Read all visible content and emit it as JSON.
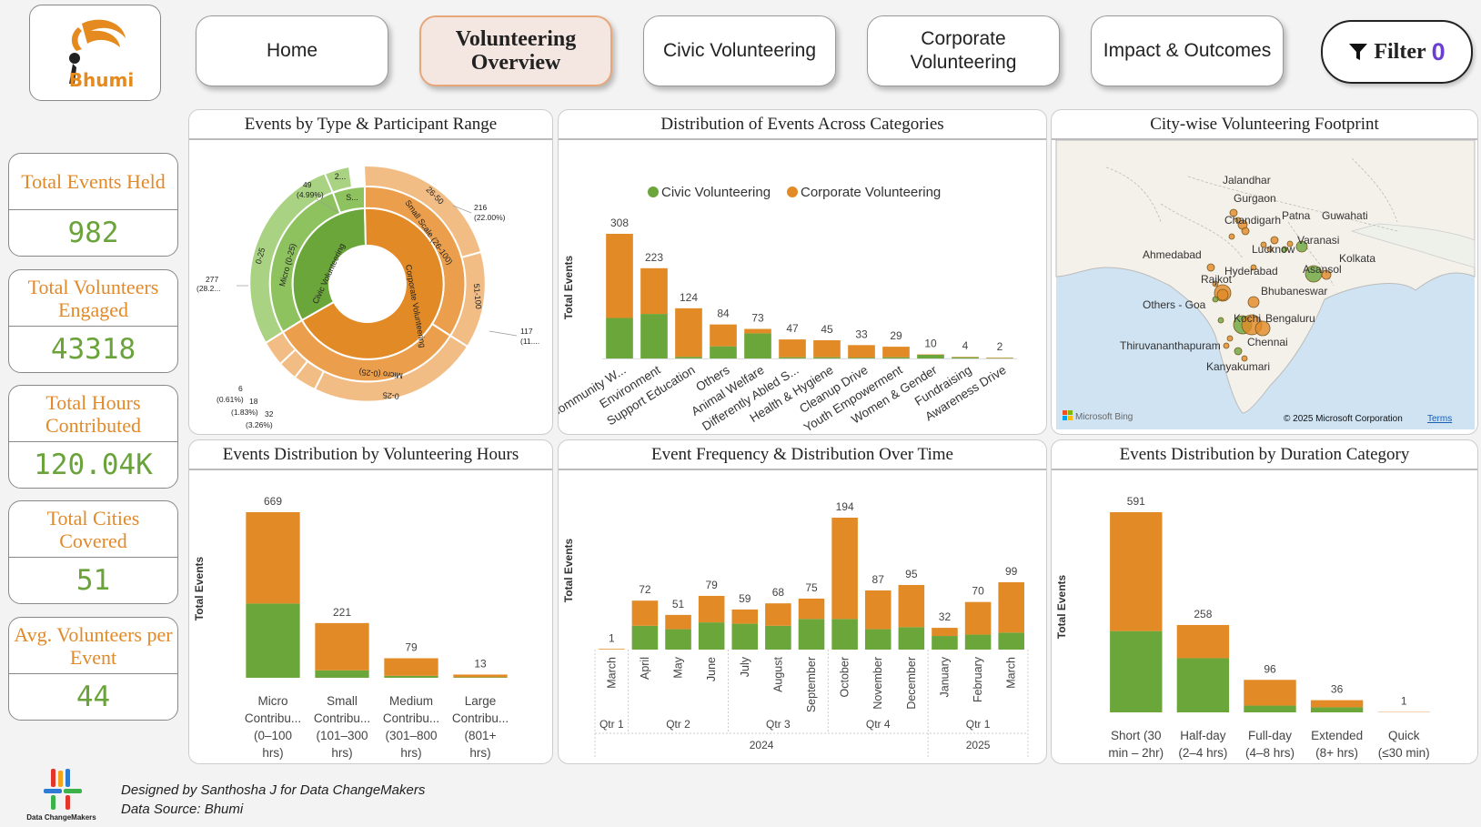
{
  "brand": {
    "name": "Bhumi"
  },
  "nav": {
    "home": "Home",
    "overview": "Volunteering Overview",
    "civic": "Civic Volunteering",
    "corporate": "Corporate Volunteering",
    "impact": "Impact & Outcomes",
    "filter_label": "Filter",
    "filter_count": "0"
  },
  "kpis": [
    {
      "title": "Total Events Held",
      "value": "982"
    },
    {
      "title": "Total Volunteers Engaged",
      "value": "43318"
    },
    {
      "title": "Total Hours Contributed",
      "value": "120.04K"
    },
    {
      "title": "Total Cities Covered",
      "value": "51"
    },
    {
      "title": "Avg. Volunteers per Event",
      "value": "44"
    }
  ],
  "colors": {
    "civic": "#6aa63a",
    "corporate": "#e28a26",
    "accent_text": "#e08a2a",
    "kpi_value": "#6aa33a",
    "filter": "#6b3fd1"
  },
  "panels": {
    "sunburst_title": "Events by Type & Participant Range",
    "categories_title": "Distribution of Events Across Categories",
    "map_title": "City-wise Volunteering Footprint",
    "hours_title": "Events Distribution by Volunteering Hours",
    "time_title": "Event Frequency & Distribution Over Time",
    "duration_title": "Events Distribution by Duration Category"
  },
  "legend": {
    "civic": "Civic Volunteering",
    "corporate": "Corporate Volunteering"
  },
  "sunburst": {
    "inner": [
      {
        "label": "Civic Volunteering"
      },
      {
        "label": "Corporate Volunteering"
      }
    ],
    "middle": [
      "Micro (0-25)",
      "S...",
      "Small Scale (26-100)",
      "Micro (0-25)"
    ],
    "outer": [
      "0-25",
      "2...",
      "26-50",
      "51-100",
      "0-25"
    ],
    "callouts": [
      {
        "value": "49",
        "pct": "(4.99%)"
      },
      {
        "value": "216",
        "pct": "(22.00%)"
      },
      {
        "value": "277",
        "pct": "(28.2..."
      },
      {
        "value": "117",
        "pct": "(11...."
      },
      {
        "value": "6",
        "pct": "(0.61%)"
      },
      {
        "value": "18",
        "pct": "(1.83%)"
      },
      {
        "value": "32",
        "pct": "(3.26%)"
      }
    ]
  },
  "map": {
    "cities": [
      "Jalandhar",
      "Gurgaon",
      "Chandigarh",
      "Patna",
      "Guwahati",
      "Varanasi",
      "Lucknow",
      "Ahmedabad",
      "Kolkata",
      "Hyderabad",
      "Asansol",
      "Rajkot",
      "Bhubaneswar",
      "Others - Goa",
      "Kochi",
      "Bengaluru",
      "Thiruvananthapuram",
      "Chennai",
      "Kanyakumari"
    ],
    "bing": "Microsoft Bing",
    "copyright": "© 2025 Microsoft Corporation",
    "terms": "Terms"
  },
  "chart_data": [
    {
      "type": "bar",
      "title": "Distribution of Events Across Categories",
      "ylabel": "Total Events",
      "categories": [
        "Community W...",
        "Environment",
        "Support Education",
        "Others",
        "Animal Welfare",
        "Differently Abled S...",
        "Health & Hygiene",
        "Cleanup Drive",
        "Youth Empowerment",
        "Women & Gender",
        "Fundraising",
        "Awareness Drive"
      ],
      "totals": [
        308,
        223,
        124,
        84,
        73,
        47,
        45,
        33,
        29,
        10,
        4,
        2
      ],
      "series": [
        {
          "name": "Civic Volunteering",
          "values": [
            100,
            110,
            4,
            30,
            62,
            3,
            3,
            2,
            3,
            9,
            3,
            1
          ]
        },
        {
          "name": "Corporate Volunteering",
          "values": [
            208,
            113,
            120,
            54,
            11,
            44,
            42,
            31,
            26,
            1,
            1,
            1
          ]
        }
      ]
    },
    {
      "type": "bar",
      "title": "Events Distribution by Volunteering Hours",
      "ylabel": "Total Events",
      "categories": [
        "Micro Contribu... (0–100 hrs)",
        "Small Contribu... (101–300 hrs)",
        "Medium Contribu... (301–800 hrs)",
        "Large Contribu... (801+ hrs)"
      ],
      "totals": [
        669,
        221,
        79,
        13
      ],
      "series": [
        {
          "name": "Civic Volunteering",
          "values": [
            300,
            30,
            8,
            2
          ]
        },
        {
          "name": "Corporate Volunteering",
          "values": [
            369,
            191,
            71,
            11
          ]
        }
      ]
    },
    {
      "type": "bar",
      "title": "Event Frequency & Distribution Over Time",
      "ylabel": "Total Events",
      "categories": [
        "March",
        "April",
        "May",
        "June",
        "July",
        "August",
        "September",
        "October",
        "November",
        "December",
        "January",
        "February",
        "March"
      ],
      "quarters": [
        {
          "label": "Qtr 1",
          "span": 1
        },
        {
          "label": "Qtr 2",
          "span": 3
        },
        {
          "label": "Qtr 3",
          "span": 3
        },
        {
          "label": "Qtr 4",
          "span": 3
        },
        {
          "label": "Qtr 1",
          "span": 3
        }
      ],
      "years": [
        {
          "label": "2024",
          "span": 10
        },
        {
          "label": "2025",
          "span": 3
        }
      ],
      "totals": [
        1,
        72,
        51,
        79,
        59,
        68,
        75,
        194,
        87,
        95,
        32,
        70,
        99
      ],
      "series": [
        {
          "name": "Civic Volunteering",
          "values": [
            0,
            35,
            30,
            40,
            38,
            35,
            45,
            45,
            30,
            33,
            20,
            22,
            25
          ]
        },
        {
          "name": "Corporate Volunteering",
          "values": [
            1,
            37,
            21,
            39,
            21,
            33,
            30,
            149,
            57,
            62,
            12,
            48,
            74
          ]
        }
      ]
    },
    {
      "type": "bar",
      "title": "Events Distribution by Duration Category",
      "ylabel": "Total Events",
      "categories": [
        "Short (30 min – 2hr)",
        "Half-day (2–4 hrs)",
        "Full-day (4–8 hrs)",
        "Extended (8+ hrs)",
        "Quick (≤30 min)"
      ],
      "totals": [
        591,
        258,
        96,
        36,
        1
      ],
      "series": [
        {
          "name": "Civic Volunteering",
          "values": [
            240,
            160,
            20,
            15,
            0
          ]
        },
        {
          "name": "Corporate Volunteering",
          "values": [
            351,
            98,
            76,
            21,
            1
          ]
        }
      ]
    }
  ],
  "footer": {
    "org": "Data ChangeMakers",
    "line1": "Designed by Santhosha J for Data ChangeMakers",
    "line2": "Data Source: Bhumi"
  }
}
